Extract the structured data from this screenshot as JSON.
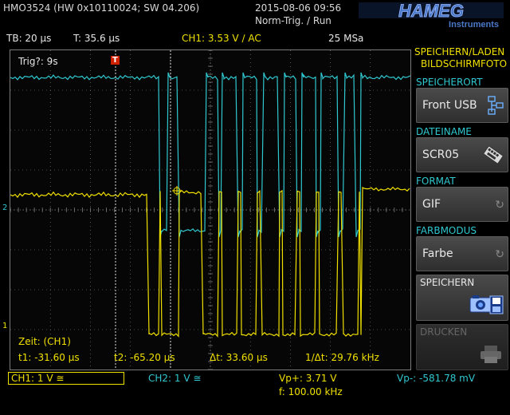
{
  "header": {
    "device": "HMO3524 (HW 0x10110024; SW 04.206)",
    "datetime": "2015-08-06 09:56",
    "trigger_status": "Norm-Trig. / Run",
    "brand": "HAMEG",
    "brand_sub": "Instruments"
  },
  "status": {
    "timebase": "TB: 20 µs",
    "trigger_time": "T: 35.6 µs",
    "trigger_info": "CH1: 3.53 V",
    "trigger_slope_symbol": "∕",
    "trigger_coupling": "AC",
    "sample_rate": "25 MSa"
  },
  "screen": {
    "trigger_label": "Trig?: 9s",
    "trigger_marker": "T",
    "ch2_marker": "2",
    "ch1_marker": "1",
    "cursor_title": "Zeit: (CH1)",
    "t1": "t1: -31.60 µs",
    "t2": "t2: -65.20 µs",
    "dt": "Δt: 33.60 µs",
    "inv_dt": "1/Δt: 29.76 kHz"
  },
  "sidebar": {
    "title_line1": "SPEICHERN/LADEN",
    "title_line2": "BILDSCHIRMFOTO",
    "sections": [
      {
        "title": "SPEICHERORT",
        "value": "Front USB"
      },
      {
        "title": "DATEINAME",
        "value": "SCR05"
      },
      {
        "title": "FORMAT",
        "value": "GIF"
      },
      {
        "title": "FARBMODUS",
        "value": "Farbe"
      }
    ],
    "save_label": "SPEICHERN",
    "print_label": "DRUCKEN"
  },
  "bottom": {
    "ch1": "CH1: 1 V",
    "ch1_coupling": "≅",
    "ch2": "CH2: 1 V",
    "ch2_coupling": "≅",
    "vp_plus": "Vp+: 3.71 V",
    "vp_minus": "Vp-: -581.78 mV",
    "freq": "f: 100.00 kHz"
  },
  "colors": {
    "ch1": "#f0e000",
    "ch2": "#30c8d0",
    "grid": "#8a8a8a",
    "brand": "#2a5aa8"
  },
  "icons": [
    "usb-drive-icon",
    "keyboard-icon",
    "rotary-knob-icon",
    "camera-save-icon",
    "printer-icon"
  ]
}
